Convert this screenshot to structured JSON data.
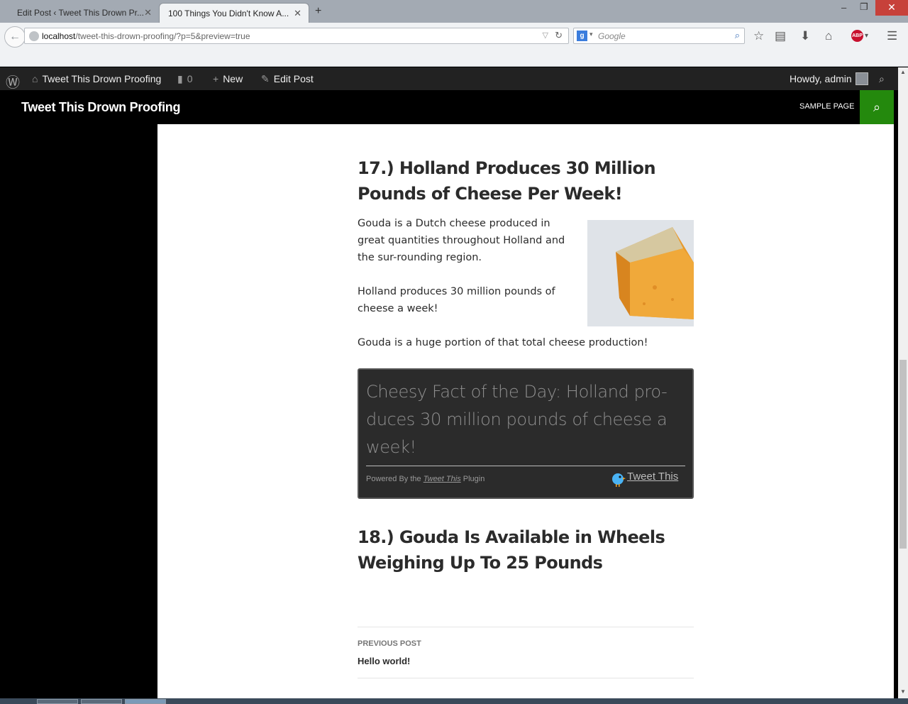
{
  "browser": {
    "tabs": [
      {
        "title": "Edit Post ‹ Tweet This Drown Pr...",
        "active": false
      },
      {
        "title": "100 Things You Didn't Know A...",
        "active": true
      }
    ],
    "url_host": "localhost",
    "url_path": "/tweet-this-drown-proofing/?p=5&preview=true",
    "search_placeholder": "Google",
    "abp_label": "ABP"
  },
  "adminbar": {
    "site_name": "Tweet This Drown Proofing",
    "comments_count": "0",
    "new_label": "New",
    "edit_label": "Edit Post",
    "howdy": "Howdy, admin"
  },
  "site": {
    "title": "Tweet This Drown Proofing",
    "nav_item": "SAMPLE PAGE"
  },
  "article": {
    "heading_17": "17.)  Holland Produces 30 Million Pounds of Cheese Per Week!",
    "p1": "Gouda is a Dutch cheese produced in great quantities throughout Holland and the sur-rounding region.",
    "p2": "Holland produces 30 million pounds of cheese a week!",
    "p3": "Gouda is a huge portion of that total cheese production!",
    "tweet": {
      "quote": "Cheesy Fact of the Day: Holland pro-duces 30 million pounds of cheese a week!",
      "powered_prefix": "Powered By the",
      "powered_link": "Tweet This",
      "powered_suffix": "Plugin",
      "tweet_link": "Tweet This"
    },
    "heading_18": "18.)  Gouda Is Available in Wheels Weighing Up To 25 Pounds"
  },
  "post_nav": {
    "meta": "Previous Post",
    "title": "Hello world!"
  },
  "colors": {
    "accent_green": "#24890d",
    "admin_bar": "#222222",
    "tweet_box": "#2b2b2b"
  }
}
